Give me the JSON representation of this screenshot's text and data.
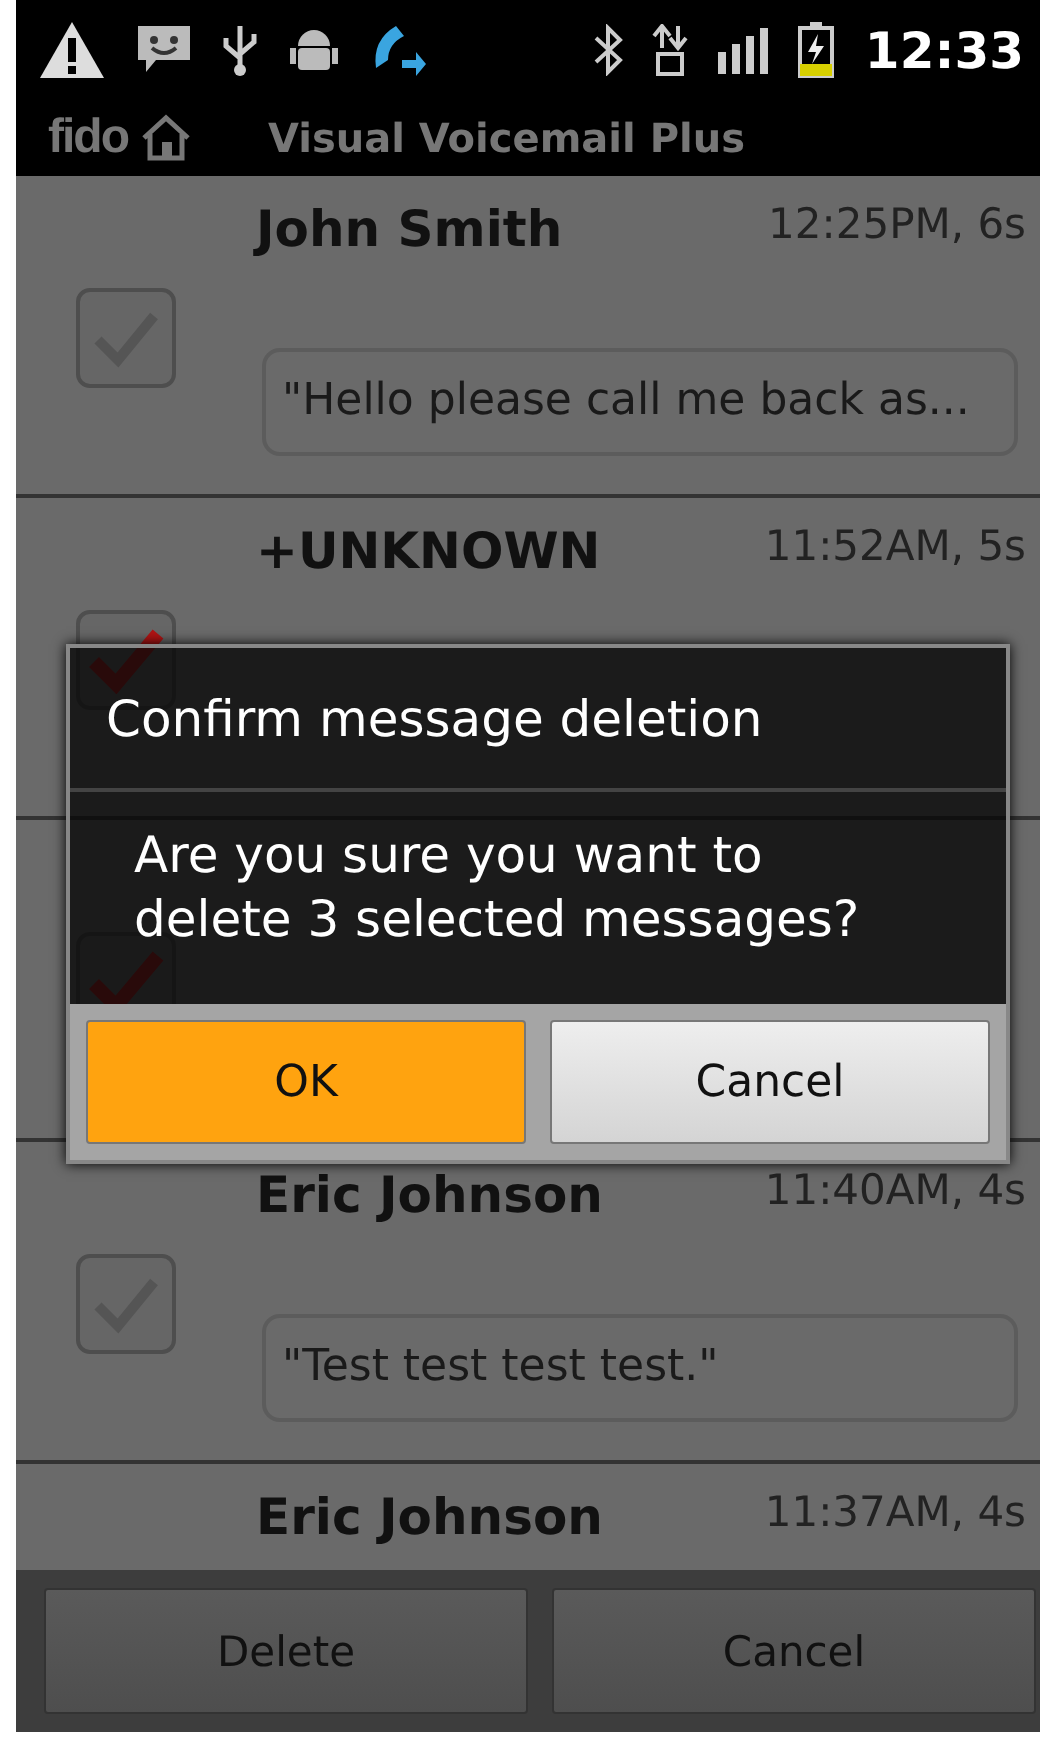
{
  "status_bar": {
    "time": "12:33"
  },
  "title_bar": {
    "logo": "fido",
    "title": "Visual Voicemail Plus"
  },
  "messages": [
    {
      "name": "John Smith",
      "time": "12:25PM, 6s",
      "transcript": "\"Hello please call me back as...",
      "checked": false
    },
    {
      "name": "+UNKNOWN",
      "time": "11:52AM, 5s",
      "checked": true
    },
    {
      "checked": true
    },
    {
      "name": "Eric Johnson",
      "time": "11:40AM, 4s",
      "transcript": "\"Test test test test.\"",
      "checked": false
    },
    {
      "name": "Eric Johnson",
      "time": "11:37AM, 4s"
    }
  ],
  "dialog": {
    "title": "Confirm message deletion",
    "message": "Are you sure you want to delete 3 selected messages?",
    "buttons": [
      {
        "label": "OK",
        "kind": "primary"
      },
      {
        "label": "Cancel",
        "kind": "secondary"
      }
    ]
  },
  "bottom_bar": {
    "buttons": [
      "Delete",
      "Cancel"
    ]
  }
}
